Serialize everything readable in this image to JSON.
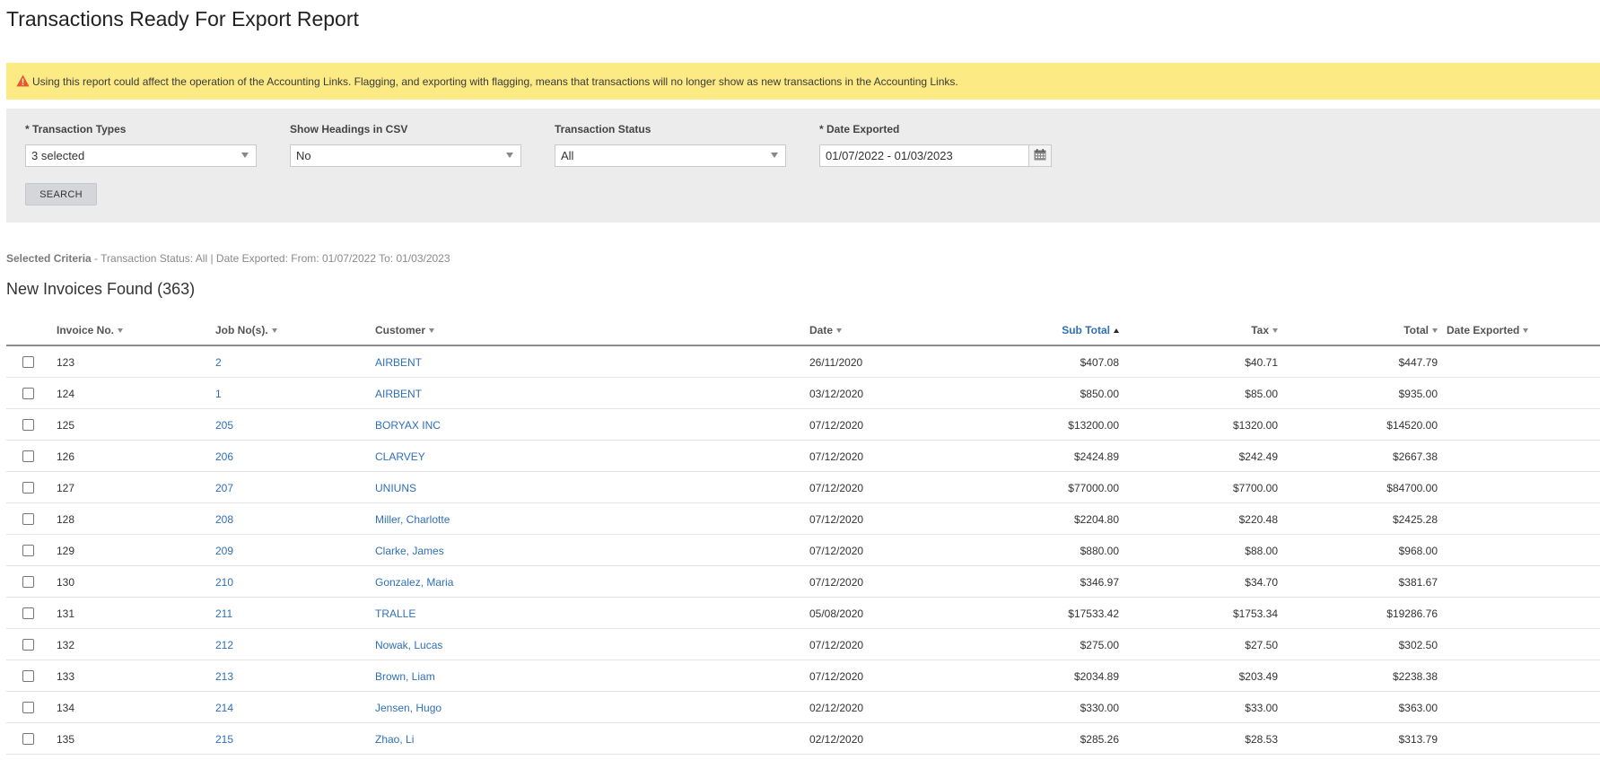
{
  "page_title": "Transactions Ready For Export Report",
  "warning": {
    "icon": "warning-triangle-icon",
    "text": "Using this report could affect the operation of the Accounting Links. Flagging, and exporting with flagging, means that transactions will no longer show as new transactions in the Accounting Links."
  },
  "filters": {
    "transaction_types": {
      "label": "* Transaction Types",
      "value": "3 selected"
    },
    "show_headings": {
      "label": "Show Headings in CSV",
      "value": "No"
    },
    "transaction_status": {
      "label": "Transaction Status",
      "value": "All"
    },
    "date_exported": {
      "label": "* Date Exported",
      "value": "01/07/2022 - 01/03/2023"
    },
    "search_label": "SEARCH"
  },
  "criteria": {
    "label": "Selected Criteria",
    "text": " - Transaction Status: All | Date Exported: From: 01/07/2022 To: 01/03/2023"
  },
  "results_title": "New Invoices Found (363)",
  "table": {
    "columns": {
      "invoice_no": "Invoice No.",
      "job_nos": "Job No(s).",
      "customer": "Customer",
      "date": "Date",
      "sub_total": "Sub Total",
      "tax": "Tax",
      "total": "Total",
      "date_exported": "Date Exported"
    },
    "rows": [
      {
        "invoice": "123",
        "job": "2",
        "customer": "AIRBENT",
        "date": "26/11/2020",
        "sub_total": "$407.08",
        "tax": "$40.71",
        "total": "$447.79",
        "date_exported": ""
      },
      {
        "invoice": "124",
        "job": "1",
        "customer": "AIRBENT",
        "date": "03/12/2020",
        "sub_total": "$850.00",
        "tax": "$85.00",
        "total": "$935.00",
        "date_exported": ""
      },
      {
        "invoice": "125",
        "job": "205",
        "customer": "BORYAX INC",
        "date": "07/12/2020",
        "sub_total": "$13200.00",
        "tax": "$1320.00",
        "total": "$14520.00",
        "date_exported": ""
      },
      {
        "invoice": "126",
        "job": "206",
        "customer": "CLARVEY",
        "date": "07/12/2020",
        "sub_total": "$2424.89",
        "tax": "$242.49",
        "total": "$2667.38",
        "date_exported": ""
      },
      {
        "invoice": "127",
        "job": "207",
        "customer": "UNIUNS",
        "date": "07/12/2020",
        "sub_total": "$77000.00",
        "tax": "$7700.00",
        "total": "$84700.00",
        "date_exported": ""
      },
      {
        "invoice": "128",
        "job": "208",
        "customer": "Miller, Charlotte",
        "date": "07/12/2020",
        "sub_total": "$2204.80",
        "tax": "$220.48",
        "total": "$2425.28",
        "date_exported": ""
      },
      {
        "invoice": "129",
        "job": "209",
        "customer": "Clarke, James",
        "date": "07/12/2020",
        "sub_total": "$880.00",
        "tax": "$88.00",
        "total": "$968.00",
        "date_exported": ""
      },
      {
        "invoice": "130",
        "job": "210",
        "customer": "Gonzalez, Maria",
        "date": "07/12/2020",
        "sub_total": "$346.97",
        "tax": "$34.70",
        "total": "$381.67",
        "date_exported": ""
      },
      {
        "invoice": "131",
        "job": "211",
        "customer": "TRALLE",
        "date": "05/08/2020",
        "sub_total": "$17533.42",
        "tax": "$1753.34",
        "total": "$19286.76",
        "date_exported": ""
      },
      {
        "invoice": "132",
        "job": "212",
        "customer": "Nowak, Lucas",
        "date": "07/12/2020",
        "sub_total": "$275.00",
        "tax": "$27.50",
        "total": "$302.50",
        "date_exported": ""
      },
      {
        "invoice": "133",
        "job": "213",
        "customer": "Brown, Liam",
        "date": "07/12/2020",
        "sub_total": "$2034.89",
        "tax": "$203.49",
        "total": "$2238.38",
        "date_exported": ""
      },
      {
        "invoice": "134",
        "job": "214",
        "customer": "Jensen, Hugo",
        "date": "02/12/2020",
        "sub_total": "$330.00",
        "tax": "$33.00",
        "total": "$363.00",
        "date_exported": ""
      },
      {
        "invoice": "135",
        "job": "215",
        "customer": "Zhao, Li",
        "date": "02/12/2020",
        "sub_total": "$285.26",
        "tax": "$28.53",
        "total": "$313.79",
        "date_exported": ""
      }
    ]
  },
  "colors": {
    "warning_bg": "#fcea85",
    "link": "#2f6fb9",
    "filter_bg": "#ececec"
  }
}
